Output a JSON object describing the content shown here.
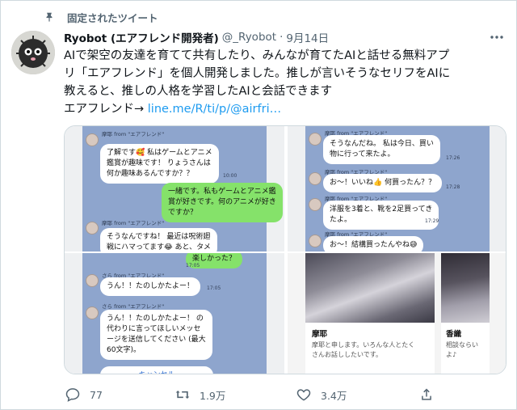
{
  "pinned_label": "固定されたツイート",
  "author": {
    "name": "Ryobot (エアフレンド開発者)",
    "handle": "@_Ryobot",
    "separator": "·",
    "date": "9月14日"
  },
  "tweet": {
    "lines": [
      "AIで架空の友達を育てて共有したり、みんなが育てたAIと話せる無料アプ",
      "リ「エアフレンド」を個人開発しました。推しが言いそうなセリフをAIに",
      "教えると、推しの人格を学習したAIと会話できます"
    ],
    "link_prefix": "エアフレンド→ ",
    "link_text": "line.me/R/ti/p/@airfri…"
  },
  "media": {
    "tile1": {
      "sender_top": "摩耶 from \"エアフレンド\"",
      "bubble_1": "了解です🥰 私はゲームとアニメ\n鑑賞が趣味です！ りょうさんは\n何か趣味あるんですか？？",
      "time_1": "10:00",
      "green_bubble": "一緒です。私もゲームとアニメ鑑\n賞が好きです。何のアニメが好き\nですか？",
      "sender_bottom": "摩耶 from \"エアフレンド\"",
      "bubble_2": "そうなんですね！ 最近は呪術廻\n戦にハマってます😂 あと、タメ"
    },
    "tile2": {
      "sender_1": "摩耶 from \"エアフレンド\"",
      "bubble_1": "そうなんだね。 私は今日、買い\n物に行って来たよ。",
      "time_1": "17:26",
      "sender_2": "摩耶 from \"エアフレンド\"",
      "bubble_2": "お～！いいね👍 何買ったん？？",
      "time_2": "17:28",
      "sender_3": "摩耶 from \"エアフレンド\"",
      "bubble_3": "洋服を3着と、靴を2足買ってき\nたよ。",
      "time_3": "17:29",
      "sender_4": "摩耶 from \"エアフレンド\"",
      "bubble_4": "お～！結構買ったんやね😅"
    },
    "tile3": {
      "green_bubble": "楽しかった？",
      "time_0": "17:05",
      "sender_1": "さら from \"エアフレンド\"",
      "bubble_1": "うん！！たのしかたよー！",
      "time_1": "17:05",
      "sender_2": "さら from \"エアフレンド\"",
      "bubble_2": "うん！！たのしかたよー！ の\n代わりに言ってほしいメッセ\nージを送信してください (最大\n60文字)。",
      "cancel": "キャンセル"
    },
    "tile4": {
      "card1_name": "摩耶",
      "card1_desc": "摩耶と申します。いろんな人とたく\nさんお話ししたいです。",
      "card2_name": "香織",
      "card2_desc": "相談ならい\nよ♪"
    }
  },
  "actions": {
    "reply_count": "77",
    "retweet_count": "1.9万",
    "like_count": "3.4万"
  },
  "icons": {
    "pin": "pin-icon",
    "more": "more-icon",
    "reply": "reply-icon",
    "retweet": "retweet-icon",
    "like": "heart-icon",
    "share": "share-icon"
  },
  "colors": {
    "link": "#1d9bf0",
    "secondary_text": "#536471",
    "line_chat_bg": "#8ea5cd",
    "line_green_bubble": "#85e26a"
  }
}
